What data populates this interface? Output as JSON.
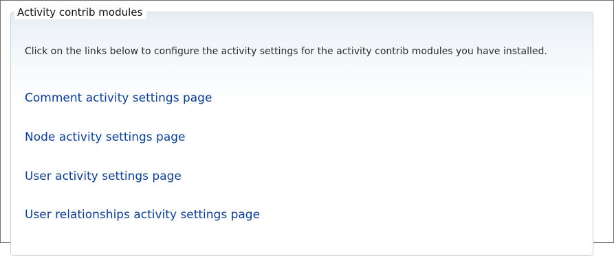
{
  "fieldset": {
    "legend": "Activity contrib modules",
    "description": "Click on the links below to configure the activity settings for the activity contrib modules you have installed."
  },
  "links": [
    {
      "label": "Comment activity settings page"
    },
    {
      "label": "Node activity settings page"
    },
    {
      "label": "User activity settings page"
    },
    {
      "label": "User relationships activity settings page"
    }
  ],
  "colors": {
    "link": "#0b3d91",
    "border": "#c9d3dc",
    "text": "#2a2a2a",
    "background_gradient_top": "#e4edf4"
  }
}
